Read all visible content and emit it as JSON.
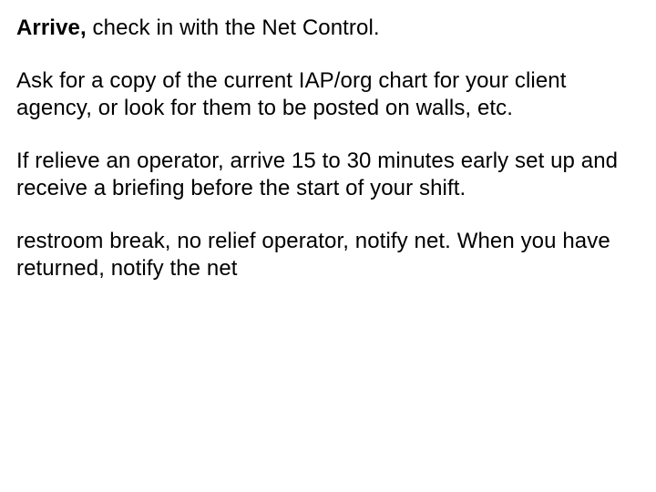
{
  "doc": {
    "p1_lead": "Arrive,",
    "p1_rest": " check in with the Net Control.",
    "p2": "Ask for a copy of the current IAP/org chart for your client agency, or look for them to be posted on walls, etc.",
    "p3": "If relieve an operator, arrive 15 to 30 minutes early set up and receive a briefing before the start of your shift.",
    "p4": "restroom break, no relief operator, notify net. When you have returned, notify the net"
  }
}
